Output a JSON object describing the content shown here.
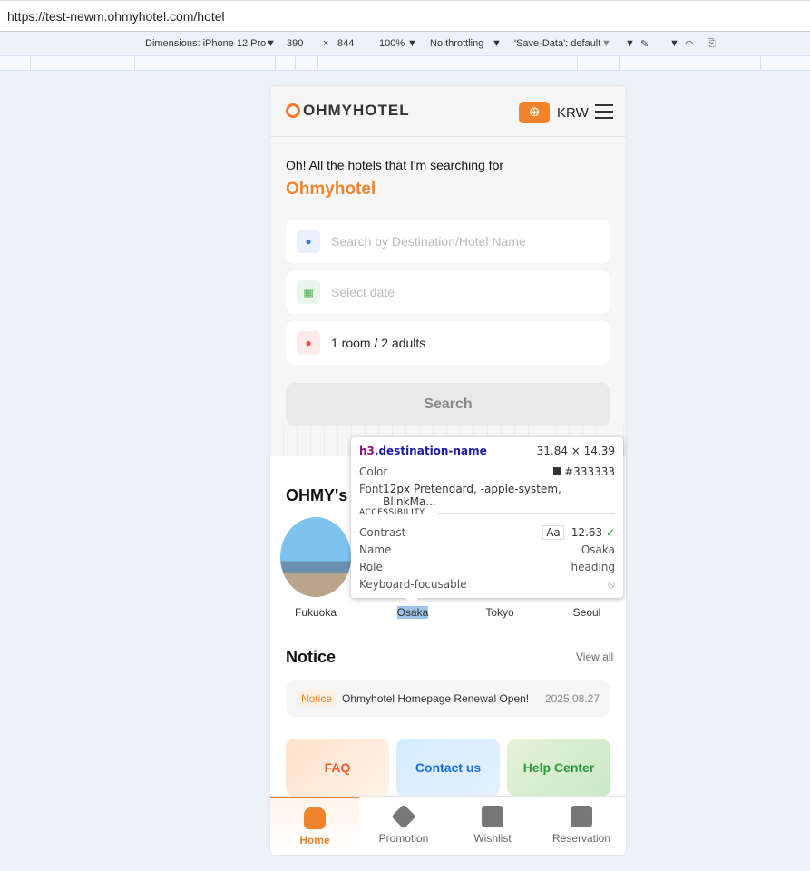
{
  "browser": {
    "url": "https://test-newm.ohmyhotel.com/hotel"
  },
  "devtools": {
    "dimensions": "Dimensions: iPhone 12 Pro",
    "width": "390",
    "x": "×",
    "height": "844",
    "zoom": "100%",
    "throttling": "No throttling",
    "save_data": "'Save-Data': default"
  },
  "header": {
    "logo": "OHMYHOTEL",
    "currency": "KRW"
  },
  "hero": {
    "tagline": "Oh! All the hotels that I'm searching for",
    "brand": "Ohmyhotel",
    "destination_placeholder": "Search by Destination/Hotel Name",
    "date_placeholder": "Select date",
    "guests": "1 room / 2 adults",
    "search_label": "Search"
  },
  "destinations": {
    "title": "OHMY's T",
    "items": [
      "Fukuoka",
      "Osaka",
      "Tokyo",
      "Seoul"
    ]
  },
  "notice": {
    "title": "Notice",
    "view_all": "View all",
    "badge": "Notice",
    "text": "Ohmyhotel Homepage Renewal Open!",
    "date": "2025.08.27"
  },
  "cards": [
    "FAQ",
    "Contact us",
    "Help Center"
  ],
  "nav": [
    "Home",
    "Promotion",
    "Wishlist",
    "Reservation"
  ],
  "inspector": {
    "tag": "h3",
    "cls": ".destination-name",
    "size": "31.84 × 14.39",
    "color_label": "Color",
    "color_value": "#333333",
    "font_label": "Font",
    "font_value": "12px Pretendard, -apple-system, BlinkMa...",
    "section": "ACCESSIBILITY",
    "contrast_label": "Contrast",
    "contrast_aa": "Aa",
    "contrast_value": "12.63",
    "name_label": "Name",
    "name_value": "Osaka",
    "role_label": "Role",
    "role_value": "heading",
    "focus_label": "Keyboard-focusable"
  }
}
